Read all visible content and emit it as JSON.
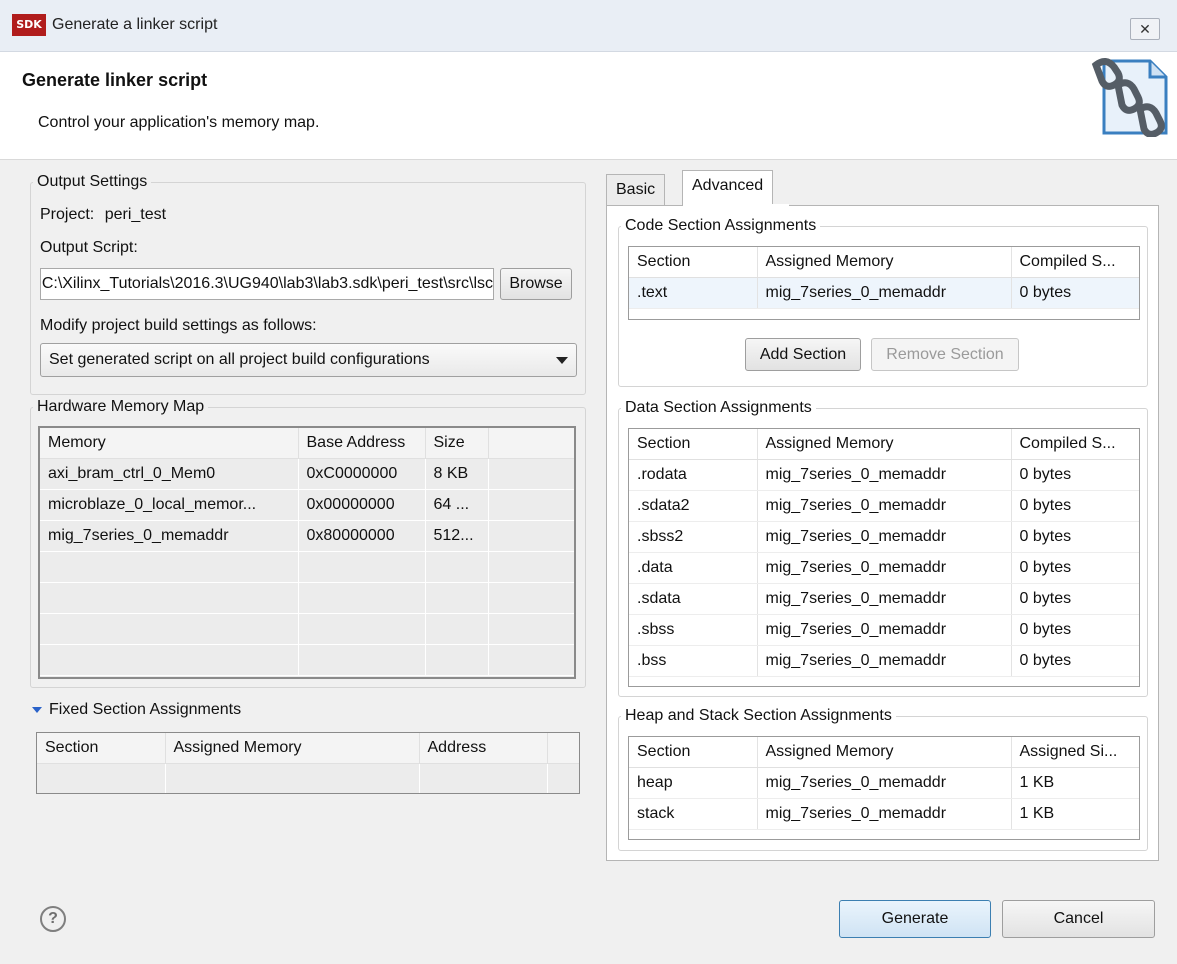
{
  "window": {
    "title": "Generate a linker script",
    "logo_text": "SDK",
    "close_glyph": "✕"
  },
  "header": {
    "title": "Generate linker script",
    "subtitle": "Control your application's memory map.",
    "icon": "chain-link-document-icon"
  },
  "output_settings": {
    "legend": "Output Settings",
    "project_label": "Project:",
    "project_value": "peri_test",
    "output_script_label": "Output Script:",
    "output_script_value": "C:\\Xilinx_Tutorials\\2016.3\\UG940\\lab3\\lab3.sdk\\peri_test\\src\\lsc",
    "browse_label": "Browse",
    "modify_label": "Modify project build settings as follows:",
    "build_option": "Set generated script on all project build configurations"
  },
  "hardware_memory_map": {
    "legend": "Hardware Memory Map",
    "columns": [
      "Memory",
      "Base Address",
      "Size"
    ],
    "rows": [
      [
        "axi_bram_ctrl_0_Mem0",
        "0xC0000000",
        "8 KB"
      ],
      [
        "microblaze_0_local_memor...",
        "0x00000000",
        "64 ..."
      ],
      [
        "mig_7series_0_memaddr",
        "0x80000000",
        "512..."
      ]
    ]
  },
  "fixed_sections": {
    "label": "Fixed Section Assignments",
    "columns": [
      "Section",
      "Assigned Memory",
      "Address"
    ]
  },
  "tabs": [
    {
      "label": "Basic"
    },
    {
      "label": "Advanced"
    }
  ],
  "code_sections": {
    "legend": "Code Section Assignments",
    "columns": [
      "Section",
      "Assigned Memory",
      "Compiled S..."
    ],
    "rows": [
      [
        ".text",
        "mig_7series_0_memaddr",
        "0  bytes"
      ]
    ],
    "add_label": "Add Section",
    "remove_label": "Remove Section"
  },
  "data_sections": {
    "legend": "Data Section Assignments",
    "columns": [
      "Section",
      "Assigned Memory",
      "Compiled S..."
    ],
    "rows": [
      [
        ".rodata",
        "mig_7series_0_memaddr",
        "0  bytes"
      ],
      [
        ".sdata2",
        "mig_7series_0_memaddr",
        "0  bytes"
      ],
      [
        ".sbss2",
        "mig_7series_0_memaddr",
        "0  bytes"
      ],
      [
        ".data",
        "mig_7series_0_memaddr",
        "0  bytes"
      ],
      [
        ".sdata",
        "mig_7series_0_memaddr",
        "0  bytes"
      ],
      [
        ".sbss",
        "mig_7series_0_memaddr",
        "0  bytes"
      ],
      [
        ".bss",
        "mig_7series_0_memaddr",
        "0  bytes"
      ]
    ]
  },
  "heap_stack_sections": {
    "legend": "Heap and Stack Section Assignments",
    "columns": [
      "Section",
      "Assigned Memory",
      "Assigned Si..."
    ],
    "rows": [
      [
        "heap",
        "mig_7series_0_memaddr",
        "1 KB"
      ],
      [
        "stack",
        "mig_7series_0_memaddr",
        "1 KB"
      ]
    ]
  },
  "footer": {
    "help_glyph": "?",
    "generate_label": "Generate",
    "cancel_label": "Cancel"
  }
}
